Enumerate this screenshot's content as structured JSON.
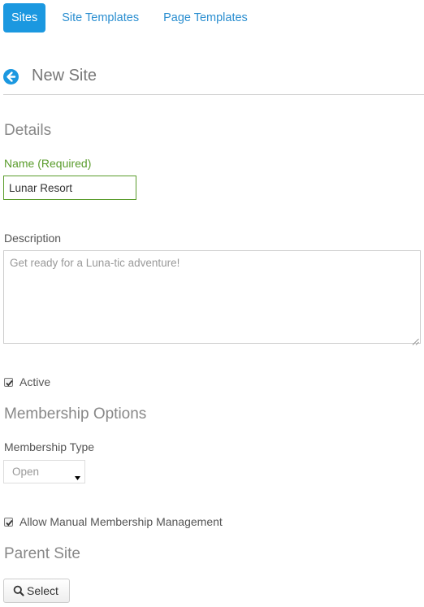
{
  "nav": {
    "tabs": [
      {
        "label": "Sites",
        "active": true
      },
      {
        "label": "Site Templates",
        "active": false
      },
      {
        "label": "Page Templates",
        "active": false
      }
    ]
  },
  "header": {
    "title": "New Site",
    "back_icon": "arrow-left-circle-icon"
  },
  "details": {
    "section_title": "Details",
    "name": {
      "label": "Name (Required)",
      "value": "Lunar Resort"
    },
    "description": {
      "label": "Description",
      "value": "Get ready for a Luna-tic adventure!"
    },
    "active": {
      "label": "Active",
      "checked": true
    }
  },
  "membership": {
    "section_title": "Membership Options",
    "type": {
      "label": "Membership Type",
      "selected": "Open"
    },
    "manual_management": {
      "label": "Allow Manual Membership Management",
      "checked": true
    }
  },
  "parent": {
    "section_title": "Parent Site",
    "select_button_label": "Select",
    "select_button_icon": "search-icon"
  },
  "colors": {
    "accent": "#1b98e0",
    "link": "#2a8ed0",
    "required_green": "#5a9c2c"
  }
}
